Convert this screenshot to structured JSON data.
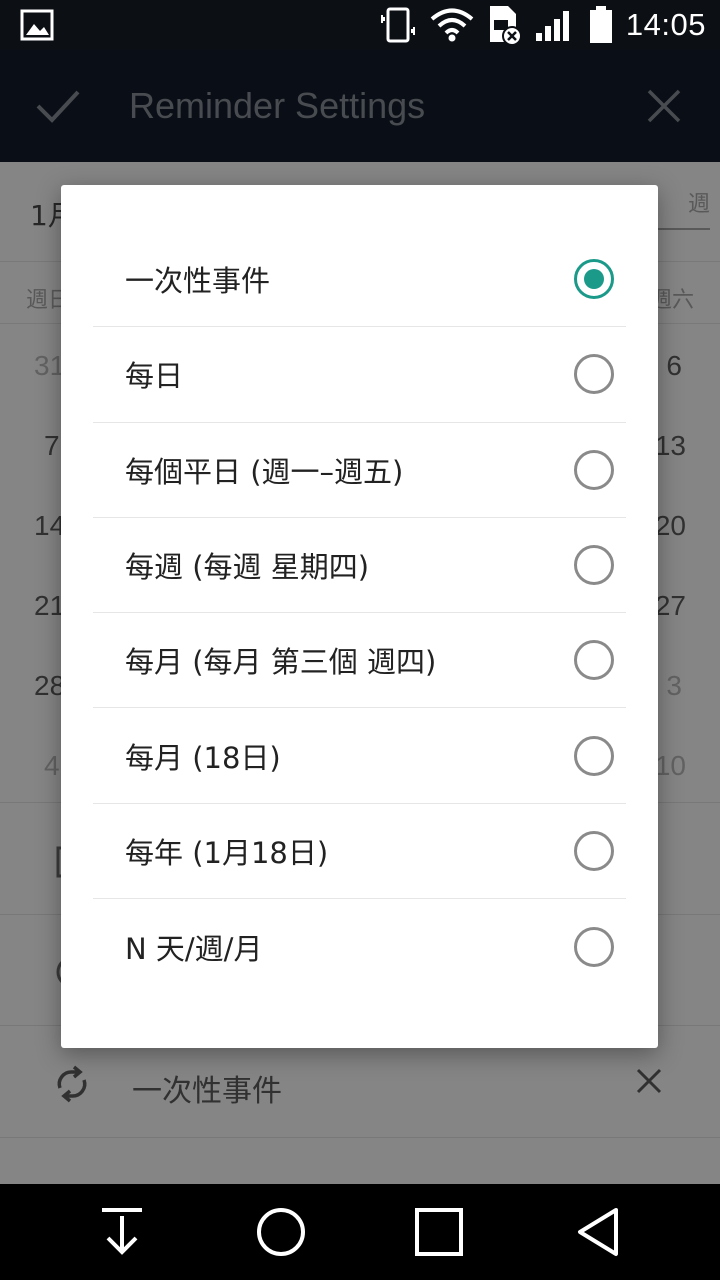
{
  "status_bar": {
    "time": "14:05",
    "icons": [
      "image-notification-icon",
      "vibrate-icon",
      "wifi-icon",
      "sim-error-icon",
      "signal-icon",
      "battery-icon"
    ]
  },
  "app_bar": {
    "title": "Reminder Settings",
    "confirm_icon": "checkmark-icon",
    "close_icon": "close-icon"
  },
  "background": {
    "month_label": "1月",
    "view_tab": "週",
    "weekday_first": "週日",
    "weekday_last": "週六",
    "dates_left": [
      "31",
      "7",
      "14",
      "21",
      "28",
      "4"
    ],
    "dates_right": [
      "6",
      "13",
      "20",
      "27",
      "3",
      "10"
    ],
    "repeat_label": "一次性事件"
  },
  "dialog": {
    "options": [
      {
        "label": "一次性事件",
        "selected": true
      },
      {
        "label": "每日",
        "selected": false
      },
      {
        "label": "每個平日 (週一–週五)",
        "selected": false
      },
      {
        "label": "每週 (每週 星期四)",
        "selected": false
      },
      {
        "label": "每月 (每月 第三個 週四)",
        "selected": false
      },
      {
        "label": "每月 (18日)",
        "selected": false
      },
      {
        "label": "每年 (1月18日)",
        "selected": false
      },
      {
        "label": "N 天/週/月",
        "selected": false
      }
    ],
    "accent_color": "#1b9a8a"
  },
  "nav_bar": {
    "icons": [
      "download-icon",
      "home-icon",
      "recents-icon",
      "back-icon"
    ]
  }
}
